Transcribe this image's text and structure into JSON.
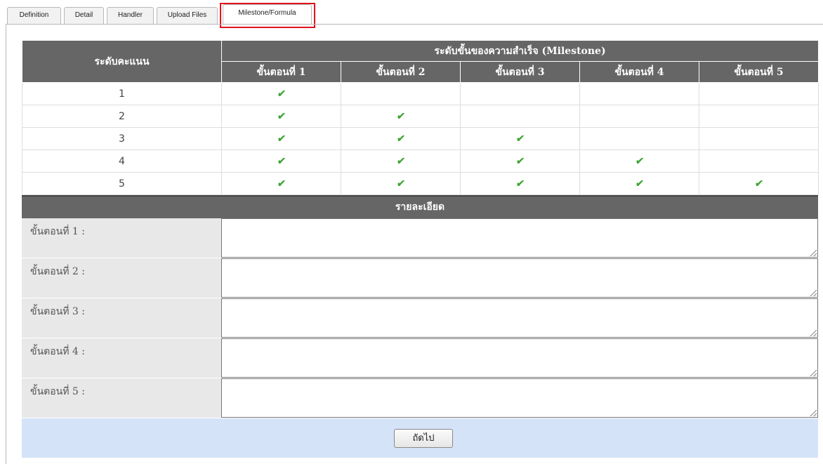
{
  "tabs": [
    "Definition",
    "Detail",
    "Handler",
    "Upload Files",
    "Milestone/Formula"
  ],
  "active_tab": "Milestone/Formula",
  "table": {
    "level_header": "ระดับคะแนน",
    "milestone_header": "ระดับขั้นของความสำเร็จ (Milestone)",
    "steps": [
      "ขั้นตอนที่ 1",
      "ขั้นตอนที่ 2",
      "ขั้นตอนที่ 3",
      "ขั้นตอนที่ 4",
      "ขั้นตอนที่ 5"
    ],
    "rows": [
      {
        "level": "1",
        "checks": [
          true,
          false,
          false,
          false,
          false
        ]
      },
      {
        "level": "2",
        "checks": [
          true,
          true,
          false,
          false,
          false
        ]
      },
      {
        "level": "3",
        "checks": [
          true,
          true,
          true,
          false,
          false
        ]
      },
      {
        "level": "4",
        "checks": [
          true,
          true,
          true,
          true,
          false
        ]
      },
      {
        "level": "5",
        "checks": [
          true,
          true,
          true,
          true,
          true
        ]
      }
    ]
  },
  "details": {
    "header": "รายละเอียด",
    "labels": [
      "ขั้นตอนที่ 1 :",
      "ขั้นตอนที่ 2 :",
      "ขั้นตอนที่ 3 :",
      "ขั้นตอนที่ 4 :",
      "ขั้นตอนที่ 5 :"
    ],
    "values": [
      "",
      "",
      "",
      "",
      ""
    ]
  },
  "buttons": {
    "next": "ถัดไป"
  },
  "colors": {
    "header_bg": "#666666",
    "check": "#3fa535",
    "footer_bg": "#d4e3f8",
    "highlight": "#e0131d"
  }
}
